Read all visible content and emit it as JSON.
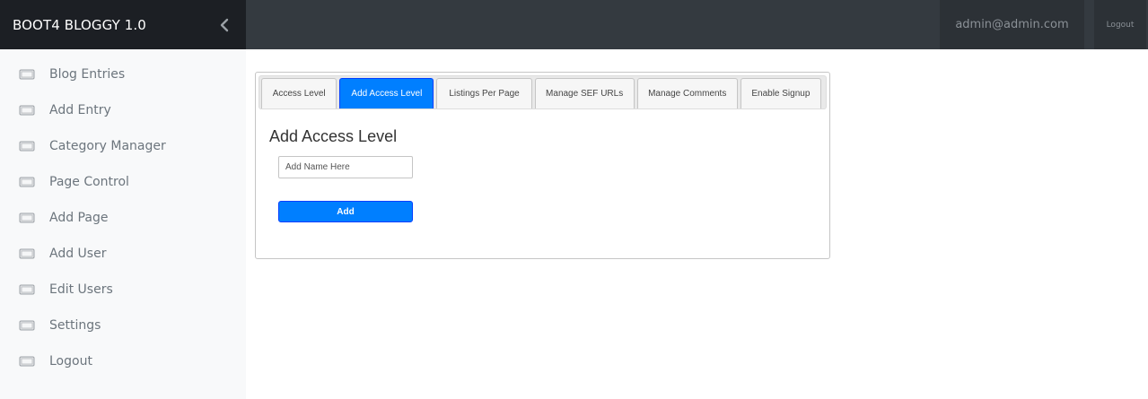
{
  "brand": {
    "title": "BOOT4 BLOGGY 1.0"
  },
  "header": {
    "user_email": "admin@admin.com",
    "logout_label": "Logout"
  },
  "sidebar": {
    "items": [
      {
        "label": "Blog Entries",
        "icon": "monitor-icon"
      },
      {
        "label": "Add Entry",
        "icon": "monitor-icon"
      },
      {
        "label": "Category Manager",
        "icon": "monitor-icon"
      },
      {
        "label": "Page Control",
        "icon": "monitor-icon"
      },
      {
        "label": "Add Page",
        "icon": "monitor-icon"
      },
      {
        "label": "Add User",
        "icon": "monitor-icon"
      },
      {
        "label": "Edit Users",
        "icon": "monitor-icon"
      },
      {
        "label": "Settings",
        "icon": "monitor-icon"
      },
      {
        "label": "Logout",
        "icon": "monitor-icon"
      }
    ]
  },
  "tabs": [
    {
      "label": "Access Level",
      "active": false
    },
    {
      "label": "Add Access Level",
      "active": true
    },
    {
      "label": "Listings Per Page",
      "active": false
    },
    {
      "label": "Manage SEF URLs",
      "active": false
    },
    {
      "label": "Manage Comments",
      "active": false
    },
    {
      "label": "Enable Signup",
      "active": false
    }
  ],
  "form": {
    "title": "Add Access Level",
    "name_value": "",
    "name_placeholder": "Add Name Here",
    "add_label": "Add"
  },
  "colors": {
    "sidebar_bg": "#f8f9fa",
    "brand_bg": "#1c1f24",
    "topbar_bg": "#343a40",
    "accent": "#007fff"
  }
}
